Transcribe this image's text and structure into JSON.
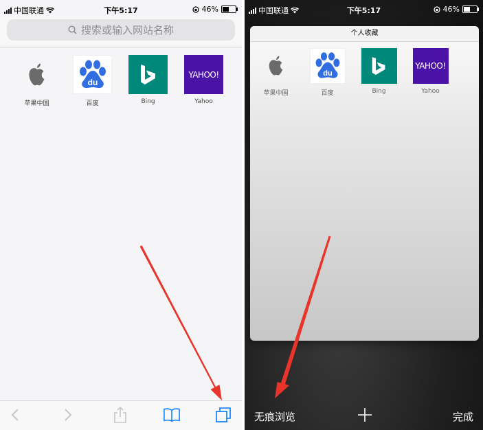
{
  "left_screen": {
    "status": {
      "carrier": "中国联通",
      "time": "下午5:17",
      "battery": "46%"
    },
    "search": {
      "placeholder": "搜索或输入网站名称"
    },
    "favorites": [
      {
        "name": "苹果中国",
        "icon": "apple-logo-icon"
      },
      {
        "name": "百度",
        "icon": "baidu-logo-icon"
      },
      {
        "name": "Bing",
        "icon": "bing-logo-icon"
      },
      {
        "name": "Yahoo",
        "icon": "yahoo-logo-icon"
      }
    ],
    "toolbar": [
      "back-icon",
      "forward-icon",
      "share-icon",
      "bookmarks-icon",
      "tabs-icon"
    ]
  },
  "right_screen": {
    "status": {
      "carrier": "中国联通",
      "time": "下午5:17",
      "battery": "46%"
    },
    "tab_card": {
      "title": "个人收藏",
      "favorites": [
        {
          "name": "苹果中国",
          "icon": "apple-logo-icon"
        },
        {
          "name": "百度",
          "icon": "baidu-logo-icon"
        },
        {
          "name": "Bing",
          "icon": "bing-logo-icon"
        },
        {
          "name": "Yahoo",
          "icon": "yahoo-logo-icon"
        }
      ]
    },
    "bottom_bar": {
      "private_label": "无痕浏览",
      "add_icon": "plus-icon",
      "done_label": "完成"
    }
  },
  "logos": {
    "yahoo_text": "YAHOO!",
    "baidu_text": "du"
  },
  "colors": {
    "accent": "#007aff",
    "arrow": "#e8342a",
    "bing": "#00897b",
    "yahoo": "#4b12a8",
    "baidu": "#2f6de1"
  }
}
